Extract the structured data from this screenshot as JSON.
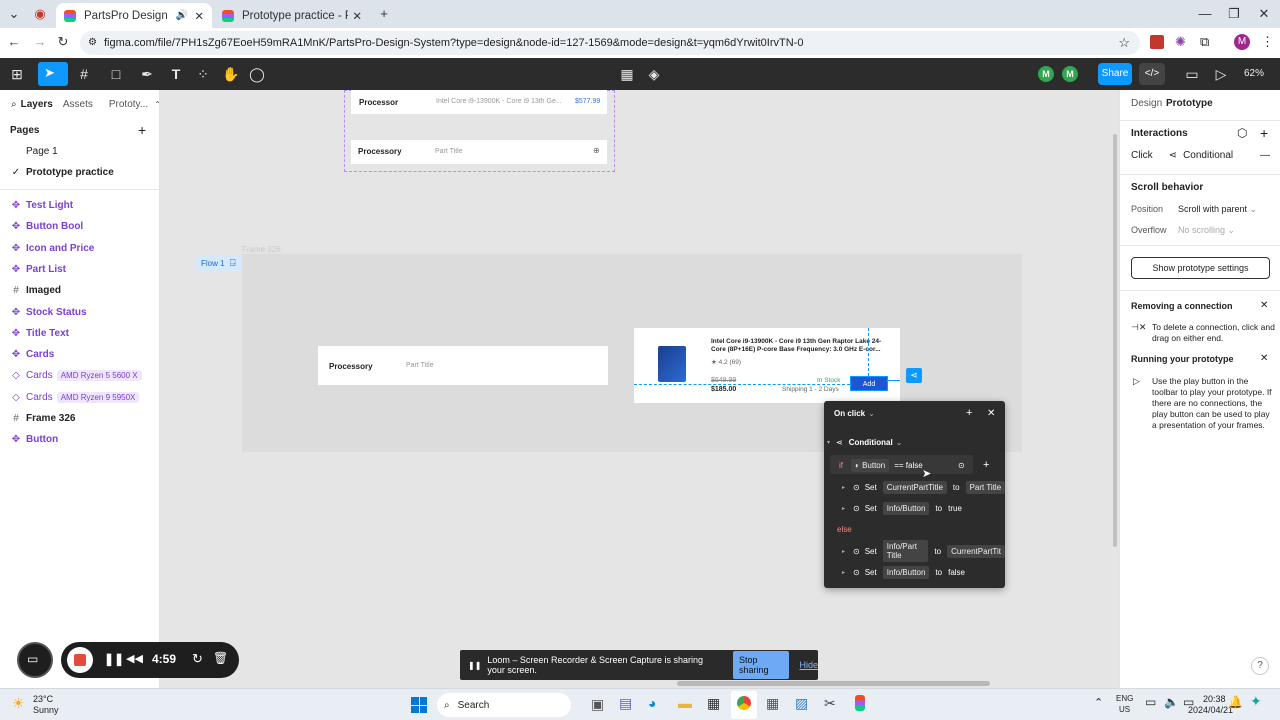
{
  "browser": {
    "tabs": [
      {
        "title": "PartsPro Design System – F",
        "active": true
      },
      {
        "title": "Prototype practice - PartsPro D",
        "active": false
      }
    ],
    "url": "figma.com/file/7PH1sZg67EoeH59mRA1MnK/PartsPro-Design-System?type=design&node-id=127-1569&mode=design&t=yqm6dYrwit0IrvTN-0",
    "profile_initial": "M"
  },
  "figma_toolbar": {
    "avatars": [
      "M",
      "M"
    ],
    "share_label": "Share",
    "zoom": "62%"
  },
  "left_panel": {
    "tabs": [
      "Layers",
      "Assets",
      "Prototy..."
    ],
    "pages_heading": "Pages",
    "pages": [
      {
        "name": "Page 1",
        "selected": false
      },
      {
        "name": "Prototype practice",
        "selected": true
      }
    ],
    "layers": [
      {
        "name": "Test Light",
        "icon": "component",
        "tag": ""
      },
      {
        "name": "Button Bool",
        "icon": "component",
        "tag": ""
      },
      {
        "name": "Icon and Price",
        "icon": "component",
        "tag": ""
      },
      {
        "name": "Part List",
        "icon": "component",
        "tag": ""
      },
      {
        "name": "Imaged",
        "icon": "frame",
        "tag": ""
      },
      {
        "name": "Stock Status",
        "icon": "component",
        "tag": ""
      },
      {
        "name": "Title Text",
        "icon": "component",
        "tag": ""
      },
      {
        "name": "Cards",
        "icon": "component",
        "tag": ""
      },
      {
        "name": "Cards",
        "icon": "instance",
        "tag": "AMD Ryzen 5 5600 X"
      },
      {
        "name": "Cards",
        "icon": "instance",
        "tag": "AMD Ryzen 9 5950X"
      },
      {
        "name": "Frame 326",
        "icon": "frame",
        "tag": ""
      },
      {
        "name": "Button",
        "icon": "component",
        "tag": ""
      }
    ]
  },
  "canvas": {
    "top_card": {
      "row1_label": "Processor",
      "row1_desc": "Intel Core i9-13900K - Core i9 13th Ge...",
      "row1_price": "$577.99",
      "row2_label": "Processory",
      "row2_desc": "Part Title"
    },
    "frame_label": "Frame 326",
    "flow_label": "Flow 1",
    "left_card": {
      "label": "Processory",
      "desc": "Part Title"
    },
    "product": {
      "title": "Intel Core i9-13900K - Core i9 13th Gen Raptor Lake 24-Core (8P+16E) P-core Base Frequency: 3.0 GHz E-cor...",
      "rating": "★ 4.2 (69)",
      "old_price": "$649.99",
      "price": "$185.00",
      "stock": "In Stock",
      "shipping": "Shipping 1 - 2 Days",
      "button": "Add"
    }
  },
  "popover": {
    "trigger": "On click",
    "action": "Conditional",
    "if_label": "if",
    "condition_var": "Button",
    "condition_op": "== false",
    "else_label": "else",
    "if_rows": [
      {
        "verb": "Set",
        "target": "CurrentPartTitle",
        "to": "to",
        "value": "Part Title"
      },
      {
        "verb": "Set",
        "target": "Info/Button",
        "to": "to",
        "value": "true"
      }
    ],
    "else_rows": [
      {
        "verb": "Set",
        "target": "Info/Part Title",
        "to": "to",
        "value": "CurrentPartTit"
      },
      {
        "verb": "Set",
        "target": "Info/Button",
        "to": "to",
        "value": "false"
      }
    ]
  },
  "right_panel": {
    "tabs": [
      "Design",
      "Prototype"
    ],
    "interactions_heading": "Interactions",
    "interaction": {
      "trigger": "Click",
      "action": "Conditional"
    },
    "scroll_heading": "Scroll behavior",
    "position_label": "Position",
    "position_value": "Scroll with parent",
    "overflow_label": "Overflow",
    "overflow_value": "No scrolling",
    "settings_button": "Show prototype settings",
    "tip1_title": "Removing a connection",
    "tip1_body": "To delete a connection, click and drag on either end.",
    "tip2_title": "Running your prototype",
    "tip2_body": "Use the play button in the toolbar to play your prototype. If there are no connections, the play button can be used to play a presentation of your frames."
  },
  "loom": {
    "timer": "4:59",
    "banner_text": "Loom – Screen Recorder & Screen Capture is sharing your screen.",
    "stop_label": "Stop sharing",
    "hide_label": "Hide"
  },
  "taskbar": {
    "weather_temp": "23°C",
    "weather_desc": "Sunny",
    "search_label": "Search",
    "lang_top": "ENG",
    "lang_bottom": "US",
    "time": "20:38",
    "date": "2024/04/21"
  },
  "colors": {
    "figma_dark": "#2c2c2c",
    "figma_blue": "#0d99ff",
    "component_purple": "#7b3fd2",
    "avatar_green": "#2fa84f",
    "loom_red": "#e5493a"
  }
}
